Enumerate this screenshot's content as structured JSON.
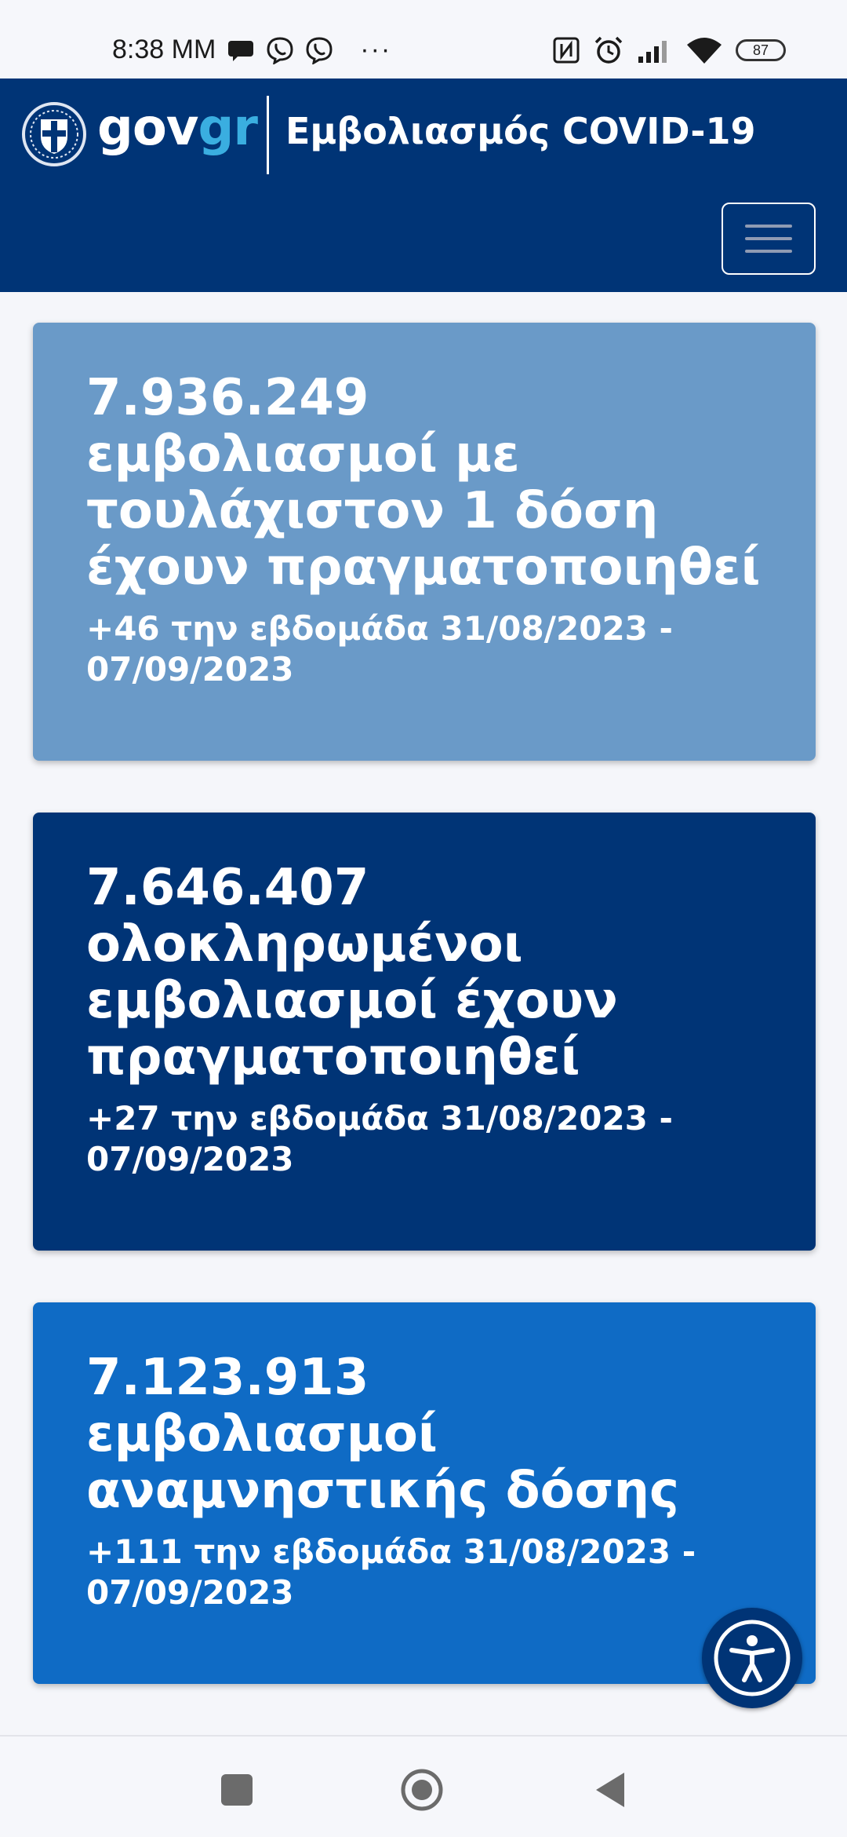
{
  "status_bar": {
    "time": "8:38 MM",
    "dots": "···",
    "battery": "87",
    "icons": [
      "chat-bubble-icon",
      "viber-icon",
      "viber-icon",
      "nfc-icon",
      "alarm-icon",
      "signal-icon",
      "wifi-icon",
      "battery-icon"
    ]
  },
  "header": {
    "brand_gov": "gov",
    "brand_gr": "gr",
    "title": "Εμβολιασμός COVID-19",
    "colors": {
      "background": "#003476",
      "brand_accent": "#3aaee0"
    }
  },
  "cards": [
    {
      "value": "7.936.249",
      "description": "εμβολιασμοί με τουλάχιστον 1 δόση έχουν πραγματοποιηθεί",
      "weekly": "+46 την εβδομάδα 31/08/2023 - 07/09/2023",
      "color": "#6a9ac8"
    },
    {
      "value": "7.646.407",
      "description": "ολοκληρωμένοι εμβολιασμοί έχουν πραγματοποιηθεί",
      "weekly": "+27 την εβδομάδα 31/08/2023 - 07/09/2023",
      "color": "#003476"
    },
    {
      "value": "7.123.913",
      "description": "εμβολιασμοί αναμνηστικής δόσης",
      "weekly": "+111 την εβδομάδα 31/08/2023 - 07/09/2023",
      "color": "#0f6bc5"
    }
  ],
  "accessibility": {
    "icon": "accessibility-icon"
  },
  "nav": {
    "icons": [
      "recents-icon",
      "home-icon",
      "back-icon"
    ]
  }
}
